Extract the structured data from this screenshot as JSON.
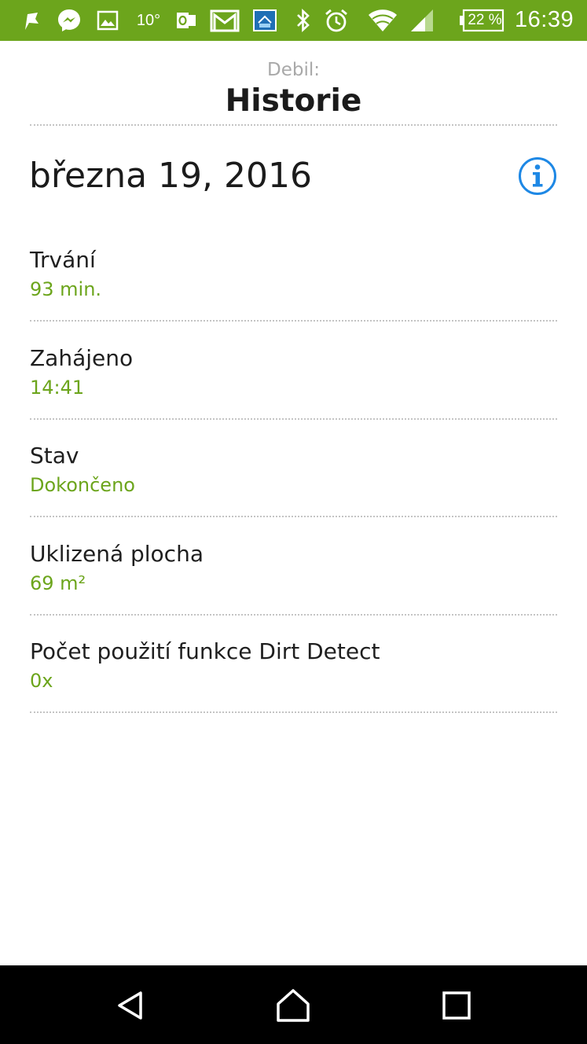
{
  "status_bar": {
    "icons": [
      "flag-icon",
      "messenger-icon",
      "gallery-icon",
      "outlook-icon",
      "gmail-icon",
      "sync-app-icon",
      "bluetooth-icon",
      "alarm-icon",
      "wifi-icon",
      "signal-icon",
      "battery-icon"
    ],
    "temperature": "10°",
    "battery": "22 %",
    "time": "16:39",
    "background_color": "#6ca51c"
  },
  "header": {
    "subtitle": "Debil:",
    "title": "Historie"
  },
  "date": "března 19, 2016",
  "info_icon": "info-icon",
  "accent_color": "#6ca51c",
  "details": [
    {
      "label": "Trvání",
      "value": "93 min."
    },
    {
      "label": "Zahájeno",
      "value": "14:41"
    },
    {
      "label": "Stav",
      "value": "Dokončeno"
    },
    {
      "label": "Uklizená plocha",
      "value": "69 m²"
    },
    {
      "label": "Počet použití funkce Dirt Detect",
      "value": "0x"
    }
  ],
  "nav_bar": {
    "buttons": [
      "back-icon",
      "home-icon",
      "recents-icon"
    ]
  }
}
